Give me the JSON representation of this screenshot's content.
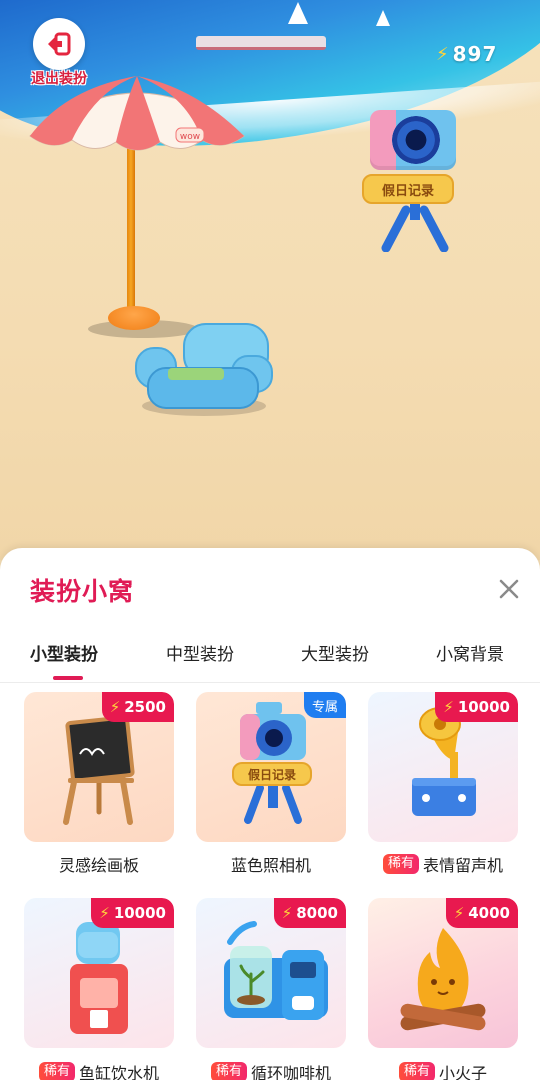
{
  "header": {
    "exit_label": "退出装扮",
    "energy_count": "897"
  },
  "scene": {
    "camera_sign": "假日记录",
    "umbrella_text": "wow"
  },
  "panel": {
    "title": "装扮小窝",
    "tabs": [
      {
        "label": "小型装扮",
        "active": true
      },
      {
        "label": "中型装扮",
        "active": false
      },
      {
        "label": "大型装扮",
        "active": false
      },
      {
        "label": "小窝背景",
        "active": false
      }
    ],
    "items": [
      {
        "name": "灵感绘画板",
        "price": "2500",
        "badge": "",
        "rare": false,
        "icon": "easel-icon"
      },
      {
        "name": "蓝色照相机",
        "price": "",
        "badge": "专属",
        "rare": false,
        "icon": "camera-icon",
        "sign": "假日记录"
      },
      {
        "name": "表情留声机",
        "price": "10000",
        "badge": "",
        "rare": true,
        "icon": "gramophone-icon"
      },
      {
        "name": "鱼缸饮水机",
        "price": "10000",
        "badge": "",
        "rare": true,
        "icon": "water-dispenser-icon"
      },
      {
        "name": "循环咖啡机",
        "price": "8000",
        "badge": "",
        "rare": true,
        "icon": "coffee-machine-icon"
      },
      {
        "name": "小火子",
        "price": "4000",
        "badge": "",
        "rare": true,
        "icon": "campfire-icon"
      }
    ],
    "rare_label": "稀有"
  },
  "colors": {
    "accent": "#e01b55",
    "price_badge": "#e8194f",
    "exclusive_badge": "#1f7df0",
    "energy_bolt": "#ffd43b"
  }
}
